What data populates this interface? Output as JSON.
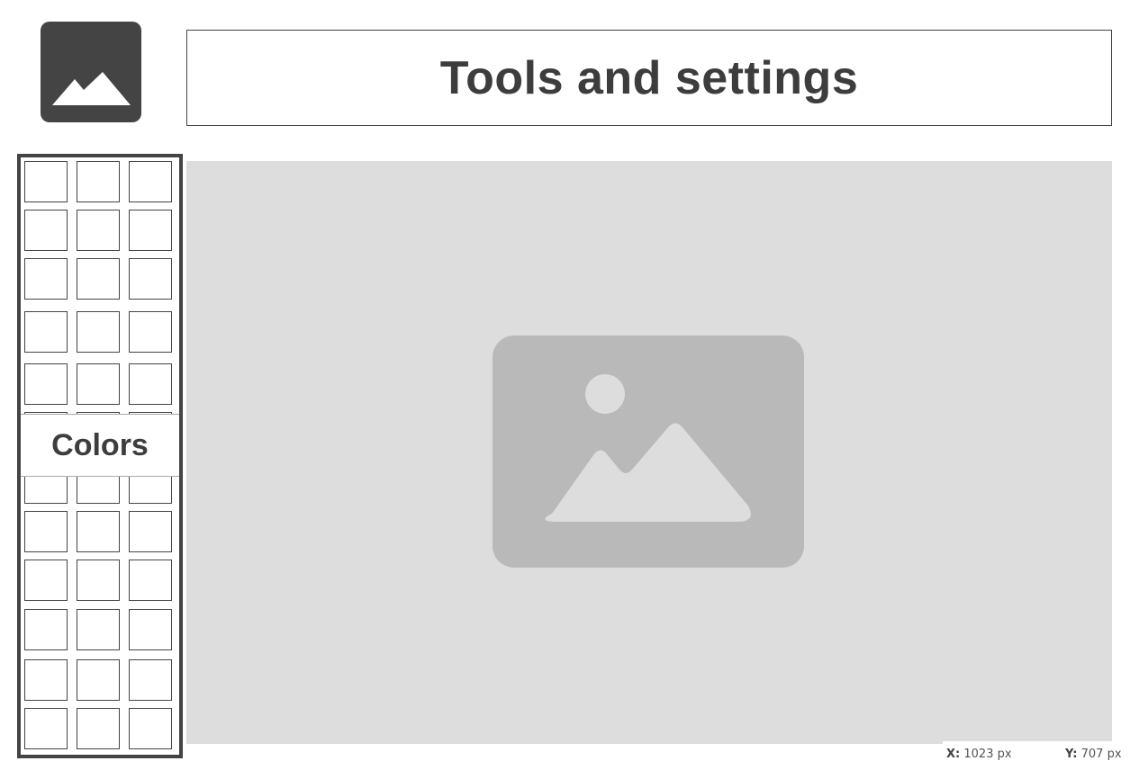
{
  "header": {
    "title": "Tools and settings",
    "logo_icon": "image-icon"
  },
  "palette": {
    "label": "Colors",
    "columns": 3,
    "rows": 12,
    "swatch_color": "#ffffff"
  },
  "canvas": {
    "background": "#dddddd",
    "placeholder_icon": "image-placeholder-icon"
  },
  "cursor": {
    "x_label": "X:",
    "x_value": "1023 px",
    "y_label": "Y:",
    "y_value": "707 px"
  },
  "colors": {
    "dark": "#444444",
    "placeholder": "#b9b9b9",
    "canvas": "#dddddd"
  }
}
